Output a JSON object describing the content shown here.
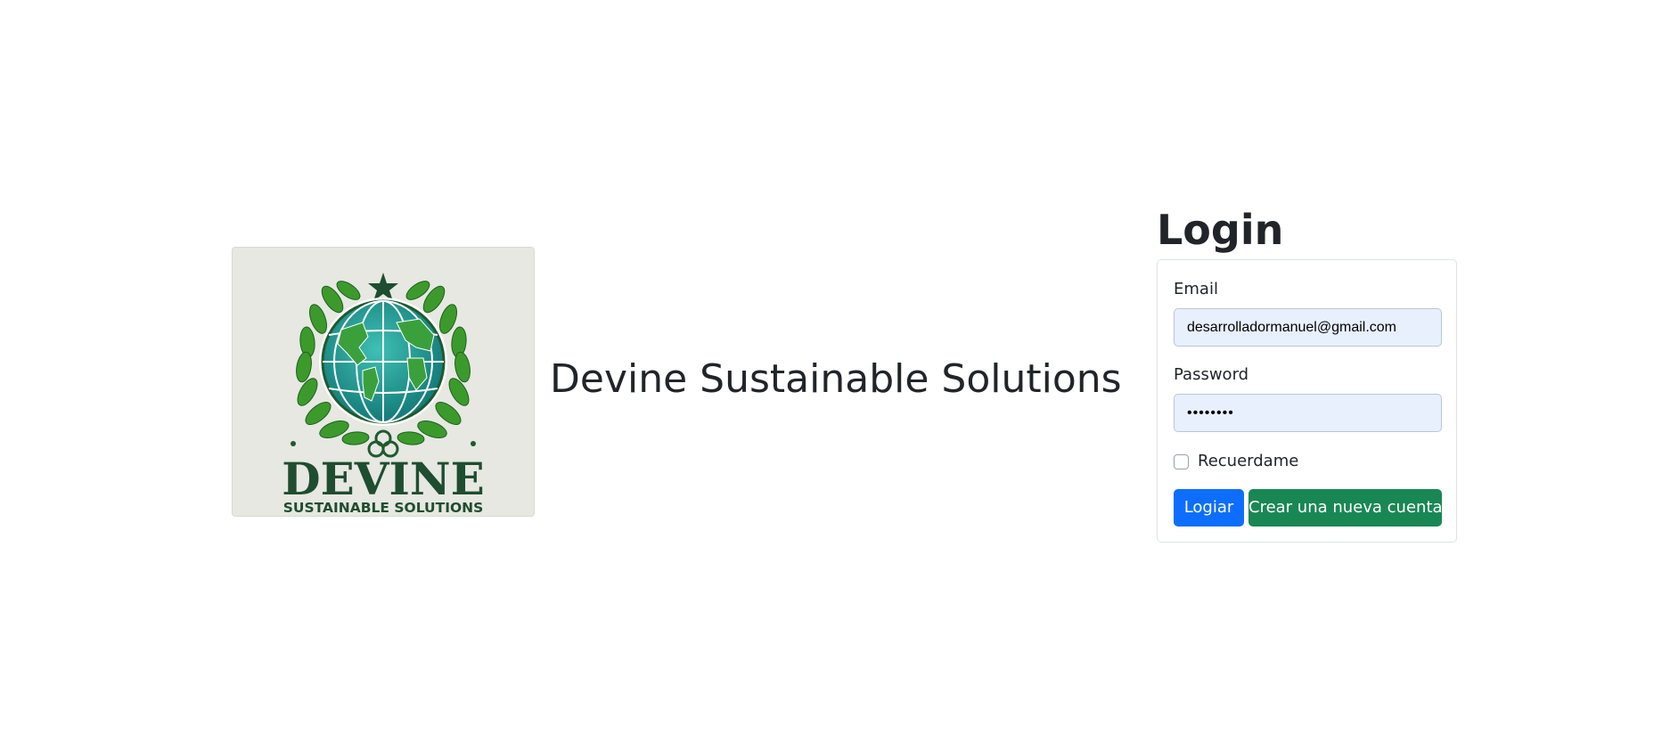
{
  "brand": {
    "name": "Devine Sustainable Solutions",
    "logo_text_main": "DEVINE",
    "logo_text_sub": "SUSTAINABLE SOLUTIONS"
  },
  "login": {
    "title": "Login",
    "email_label": "Email",
    "email_value": "desarrolladormanuel@gmail.com",
    "password_label": "Password",
    "password_value": "••••••••",
    "remember_label": "Recuerdame",
    "remember_checked": false,
    "submit_label": "Logiar",
    "register_label": "Crear una nueva cuenta"
  },
  "colors": {
    "primary": "#0d6efd",
    "success": "#198754",
    "autofill_bg": "#e8f0fe",
    "logo_green": "#1f5a2e",
    "globe_teal": "#1f9a9a"
  }
}
